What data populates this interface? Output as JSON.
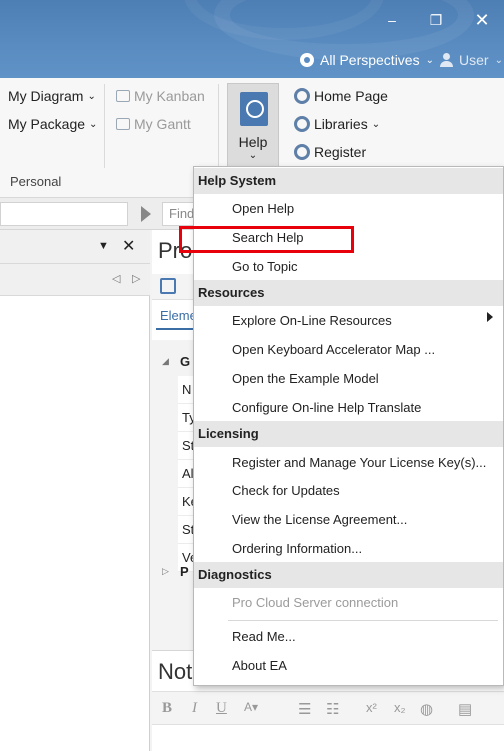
{
  "window": {
    "minimize_glyph": "–",
    "maximize_glyph": "❐",
    "close_glyph": "✕"
  },
  "header": {
    "perspectives_label": "All Perspectives",
    "user_label": "User"
  },
  "ribbon": {
    "my_diagram": "My Diagram",
    "my_package": "My Package",
    "my_kanban": "My Kanban",
    "my_gantt": "My Gantt",
    "help_label": "Help",
    "home_page": "Home Page",
    "libraries": "Libraries",
    "register": "Register",
    "group_personal": "Personal"
  },
  "search": {
    "find_placeholder": "Find"
  },
  "properties": {
    "title": "Pro",
    "tab_label": "Eleme",
    "group_label": "G",
    "rows": [
      "N",
      "Ty",
      "St",
      "Al",
      "Ke",
      "St",
      "Ve"
    ],
    "group2_label": "P"
  },
  "notes": {
    "title": "Not"
  },
  "help_menu": {
    "sections": [
      {
        "header": "Help System",
        "items": [
          "Open Help",
          "Search Help",
          "Go to Topic"
        ]
      },
      {
        "header": "Resources",
        "items": [
          "Explore On-Line Resources",
          "Open Keyboard Accelerator Map ...",
          "Open the Example Model",
          "Configure On-line Help Translate"
        ]
      },
      {
        "header": "Licensing",
        "items": [
          "Register and Manage Your License Key(s)...",
          "Check for Updates",
          "View the License Agreement...",
          "Ordering Information..."
        ]
      },
      {
        "header": "Diagnostics",
        "items": [
          "Pro Cloud Server connection",
          "Read Me...",
          "About EA"
        ]
      }
    ]
  },
  "colors": {
    "accent": "#4a78b0",
    "highlight_box": "#e8000b"
  }
}
